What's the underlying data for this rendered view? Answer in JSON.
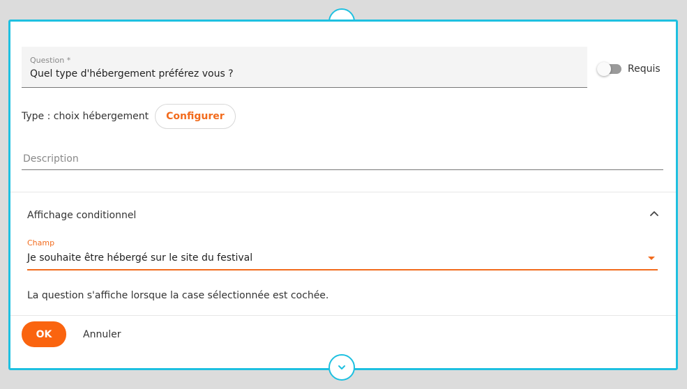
{
  "question": {
    "label": "Question *",
    "value": "Quel type d'hébergement préférez vous ?"
  },
  "required_toggle": {
    "label": "Requis",
    "on": false
  },
  "type_line": {
    "label": "Type : choix hébergement",
    "configure_label": "Configurer"
  },
  "description": {
    "placeholder": "Description",
    "value": ""
  },
  "conditional": {
    "header": "Affichage conditionnel",
    "field_label": "Champ",
    "field_value": "Je souhaite être hébergé sur le site du festival",
    "info": "La question s'affiche lorsque la case sélectionnée est cochée."
  },
  "actions": {
    "ok_label": "OK",
    "cancel_label": "Annuler"
  },
  "icons": {
    "nav_up": "chevron-up-icon",
    "nav_down": "chevron-down-icon",
    "collapse": "chevron-up-icon",
    "dropdown": "caret-down-icon"
  },
  "colors": {
    "accent_cyan": "#1ec0e0",
    "accent_orange": "#fa640f",
    "background": "#dcdcdc"
  }
}
